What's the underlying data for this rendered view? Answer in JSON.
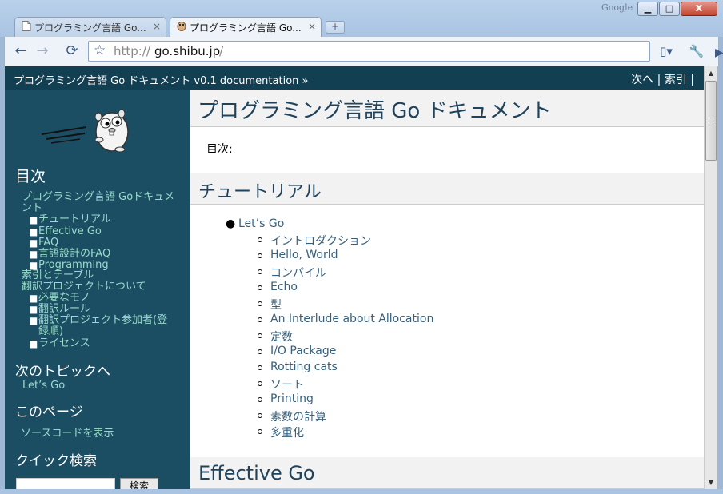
{
  "window": {
    "brand": "Google",
    "min_glyph": "▁",
    "max_glyph": "□",
    "close_glyph": "X"
  },
  "tabs": [
    {
      "label": "プログラミング言語 Go...",
      "close": "×",
      "active": false
    },
    {
      "label": "プログラミング言語 Go...",
      "close": "×",
      "active": true
    }
  ],
  "newtab": "+",
  "toolbar": {
    "back": "←",
    "forward": "→",
    "reload": "⟳",
    "star": "☆",
    "url_prefix": "http://",
    "url_host": "go.shibu.jp",
    "url_suffix": "/",
    "go": "▶",
    "page_menu": "▯▾",
    "wrench_menu": "🔧▾"
  },
  "relbar": {
    "home": "プログラミング言語 Go ドキュメント  v0.1 documentation »",
    "next": "次へ",
    "sep1": " | ",
    "index": "索引",
    "sep2": " |"
  },
  "sidebar": {
    "toc_title": "目次",
    "toc_root": "プログラミング言語 Goドキュメント",
    "toc_items": [
      "チュートリアル",
      "Effective Go",
      "FAQ",
      "言語設計のFAQ",
      "Programming"
    ],
    "index_tables": "索引とテーブル",
    "about_translation": "翻訳プロジェクトについて",
    "about_items": [
      "必要なモノ",
      "翻訳ルール",
      "翻訳プロジェクト参加者(登録順)",
      "ライセンス"
    ],
    "next_topic_title": "次のトピックへ",
    "next_topic": "Let’s Go",
    "this_page_title": "このページ",
    "show_source": "ソースコードを表示",
    "quick_search_title": "クイック検索",
    "search_button": "検索",
    "bullet": "■"
  },
  "main": {
    "title": "プログラミング言語 Go ドキュメント",
    "toc_label": "目次:",
    "tutorial_heading": "チュートリアル",
    "tutorial_root": "Let’s Go",
    "tutorial_items": [
      "イントロダクション",
      "Hello, World",
      "コンパイル",
      "Echo",
      "型",
      "An Interlude about Allocation",
      "定数",
      "I/O Package",
      "Rotting cats",
      "ソート",
      "Printing",
      "素数の計算",
      "多重化"
    ],
    "effective_heading": "Effective Go"
  },
  "colors": {
    "relbar": "#133f52",
    "sidebar": "#1c4e63",
    "sidebar_link": "#98dbcc",
    "heading": "#20435c",
    "link": "#355f7c"
  },
  "icons": [
    "file-icon",
    "gopher-icon",
    "back-arrow-icon",
    "forward-arrow-icon",
    "reload-icon",
    "star-icon",
    "go-icon",
    "page-menu-icon",
    "wrench-icon"
  ]
}
